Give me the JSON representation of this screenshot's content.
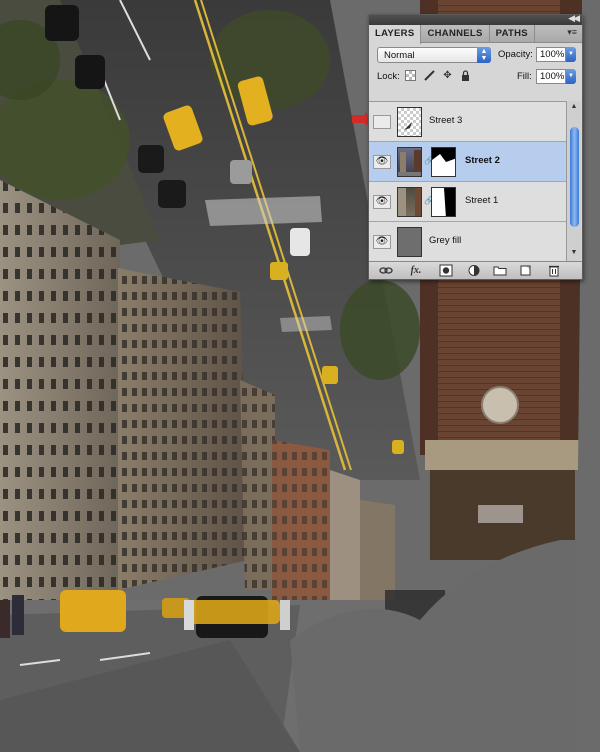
{
  "panel": {
    "tabs": [
      "LAYERS",
      "CHANNELS",
      "PATHS"
    ],
    "active_tab": "LAYERS",
    "collapse_glyph": "◀◀",
    "menu_glyph": "▾≡"
  },
  "blend": {
    "mode": "Normal"
  },
  "opacity": {
    "label": "Opacity:",
    "value": "100%"
  },
  "lock": {
    "label": "Lock:"
  },
  "fill": {
    "label": "Fill:",
    "value": "100%"
  },
  "layers": [
    {
      "name": "Street 3",
      "visible": false,
      "selected": false
    },
    {
      "name": "Street 2",
      "visible": true,
      "selected": true
    },
    {
      "name": "Street 1",
      "visible": true,
      "selected": false
    },
    {
      "name": "Grey fill",
      "visible": true,
      "selected": false
    }
  ],
  "footer_icons": [
    "link-icon",
    "fx-icon",
    "mask-icon",
    "adjustment-icon",
    "folder-icon",
    "new-layer-icon",
    "trash-icon"
  ],
  "footer_glyphs": {
    "fx": "fx."
  },
  "colors": {
    "selection": "#b6cdee",
    "arrow": "#d32a2a",
    "scroll_thumb": "#3c79d8"
  }
}
